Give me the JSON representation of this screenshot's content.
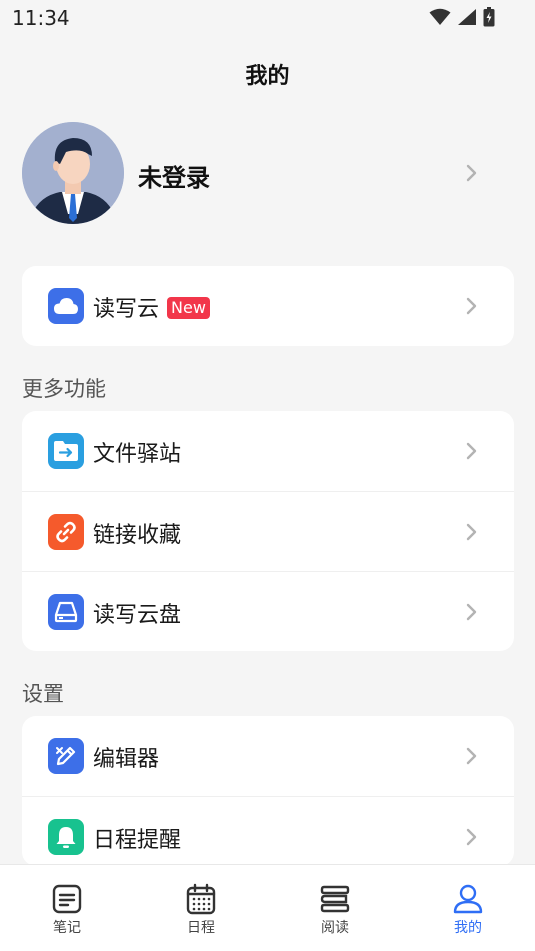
{
  "status_bar": {
    "time": "11:34"
  },
  "page_title": "我的",
  "profile": {
    "name": "未登录"
  },
  "cloud_card": {
    "label": "读写云",
    "badge": "New"
  },
  "more_features": {
    "title": "更多功能",
    "items": [
      {
        "label": "文件驿站",
        "icon": "file-transfer-icon",
        "color": "#2a9fe0"
      },
      {
        "label": "链接收藏",
        "icon": "link-icon",
        "color": "#f55a2c"
      },
      {
        "label": "读写云盘",
        "icon": "cloud-disk-icon",
        "color": "#3d6fe8"
      }
    ]
  },
  "settings": {
    "title": "设置",
    "items": [
      {
        "label": "编辑器",
        "icon": "editor-icon",
        "color": "#3d6fe8"
      },
      {
        "label": "日程提醒",
        "icon": "bell-icon",
        "color": "#18c28f"
      }
    ]
  },
  "tabbar": {
    "tabs": [
      {
        "label": "笔记",
        "icon": "notes-icon",
        "active": false
      },
      {
        "label": "日程",
        "icon": "calendar-icon",
        "active": false
      },
      {
        "label": "阅读",
        "icon": "books-icon",
        "active": false
      },
      {
        "label": "我的",
        "icon": "user-icon",
        "active": true
      }
    ]
  },
  "colors": {
    "accent": "#2f6ef5",
    "badge": "#f2364a",
    "background": "#f5f5f5"
  }
}
